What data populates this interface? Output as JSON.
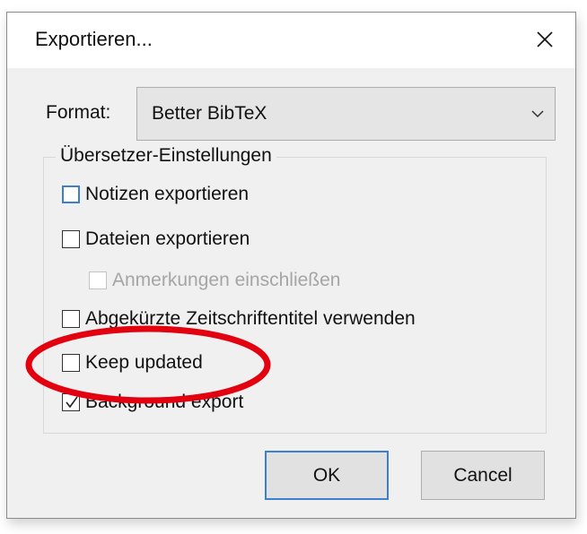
{
  "dialog": {
    "title": "Exportieren...",
    "close_icon": "close-icon"
  },
  "format": {
    "label": "Format:",
    "selected": "Better BibTeX",
    "arrow_icon": "chevron-down-icon"
  },
  "group": {
    "legend": "Übersetzer-Einstellungen",
    "options": [
      {
        "label": "Notizen exportieren",
        "checked": false,
        "enabled": true,
        "focused": true
      },
      {
        "label": "Dateien exportieren",
        "checked": false,
        "enabled": true,
        "focused": false
      },
      {
        "label": "Anmerkungen einschließen",
        "checked": false,
        "enabled": false,
        "focused": false
      },
      {
        "label": "Abgekürzte Zeitschriftentitel verwenden",
        "checked": false,
        "enabled": true,
        "focused": false
      },
      {
        "label": "Keep updated",
        "checked": false,
        "enabled": true,
        "focused": false
      },
      {
        "label": "Background export",
        "checked": true,
        "enabled": true,
        "focused": false
      }
    ]
  },
  "buttons": {
    "ok": "OK",
    "cancel": "Cancel"
  },
  "annotation": {
    "shape": "ellipse",
    "color": "#e3000f",
    "target": "Keep updated"
  },
  "colors": {
    "focus_accent": "#3c7fd0",
    "dialog_bg": "#f0f0f0",
    "disabled_text": "#a5a5a5"
  }
}
